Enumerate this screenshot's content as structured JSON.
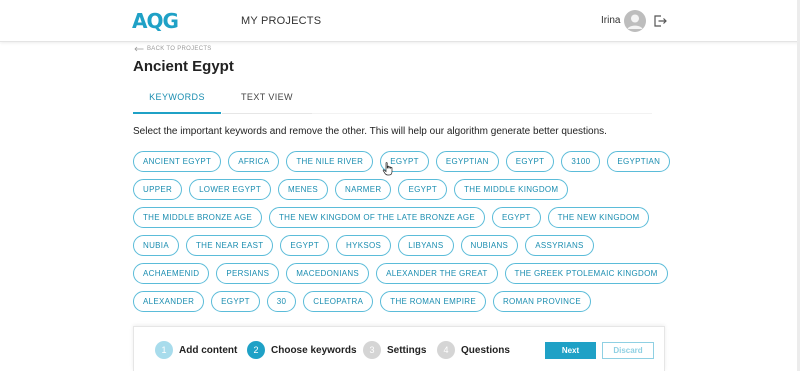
{
  "header": {
    "logo_text": "AQG",
    "nav_projects": "MY PROJECTS",
    "user_name": "Irina"
  },
  "breadcrumb": {
    "back_label": "BACK TO PROJECTS"
  },
  "page": {
    "title": "Ancient Egypt"
  },
  "tabs": [
    {
      "label": "KEYWORDS",
      "active": true
    },
    {
      "label": "TEXT VIEW",
      "active": false
    }
  ],
  "instructions": "Select the important keywords and remove the other. This will help our algorithm generate better questions.",
  "keywords": [
    "ANCIENT EGYPT",
    "AFRICA",
    "THE NILE RIVER",
    "EGYPT",
    "EGYPTIAN",
    "EGYPT",
    "3100",
    "EGYPTIAN",
    "UPPER",
    "LOWER EGYPT",
    "MENES",
    "NARMER",
    "EGYPT",
    "THE MIDDLE KINGDOM",
    "THE MIDDLE BRONZE AGE",
    "THE NEW KINGDOM OF THE LATE BRONZE AGE",
    "EGYPT",
    "THE NEW KINGDOM",
    "NUBIA",
    "THE NEAR EAST",
    "EGYPT",
    "HYKSOS",
    "LIBYANS",
    "NUBIANS",
    "ASSYRIANS",
    "ACHAEMENID",
    "PERSIANS",
    "MACEDONIANS",
    "ALEXANDER THE GREAT",
    "THE GREEK PTOLEMAIC KINGDOM",
    "ALEXANDER",
    "EGYPT",
    "30",
    "CLEOPATRA",
    "THE ROMAN EMPIRE",
    "ROMAN PROVINCE"
  ],
  "stepper": {
    "steps": [
      {
        "number": "1",
        "label": "Add content"
      },
      {
        "number": "2",
        "label": "Choose keywords"
      },
      {
        "number": "3",
        "label": "Settings"
      },
      {
        "number": "4",
        "label": "Questions"
      }
    ],
    "current_step": 2,
    "next_label": "Next",
    "discard_label": "Discard"
  },
  "colors": {
    "accent": "#1fa1c6",
    "chip_border": "#5bbcd9",
    "step_done": "#a8dcec",
    "step_pending": "#d5d5d5"
  }
}
